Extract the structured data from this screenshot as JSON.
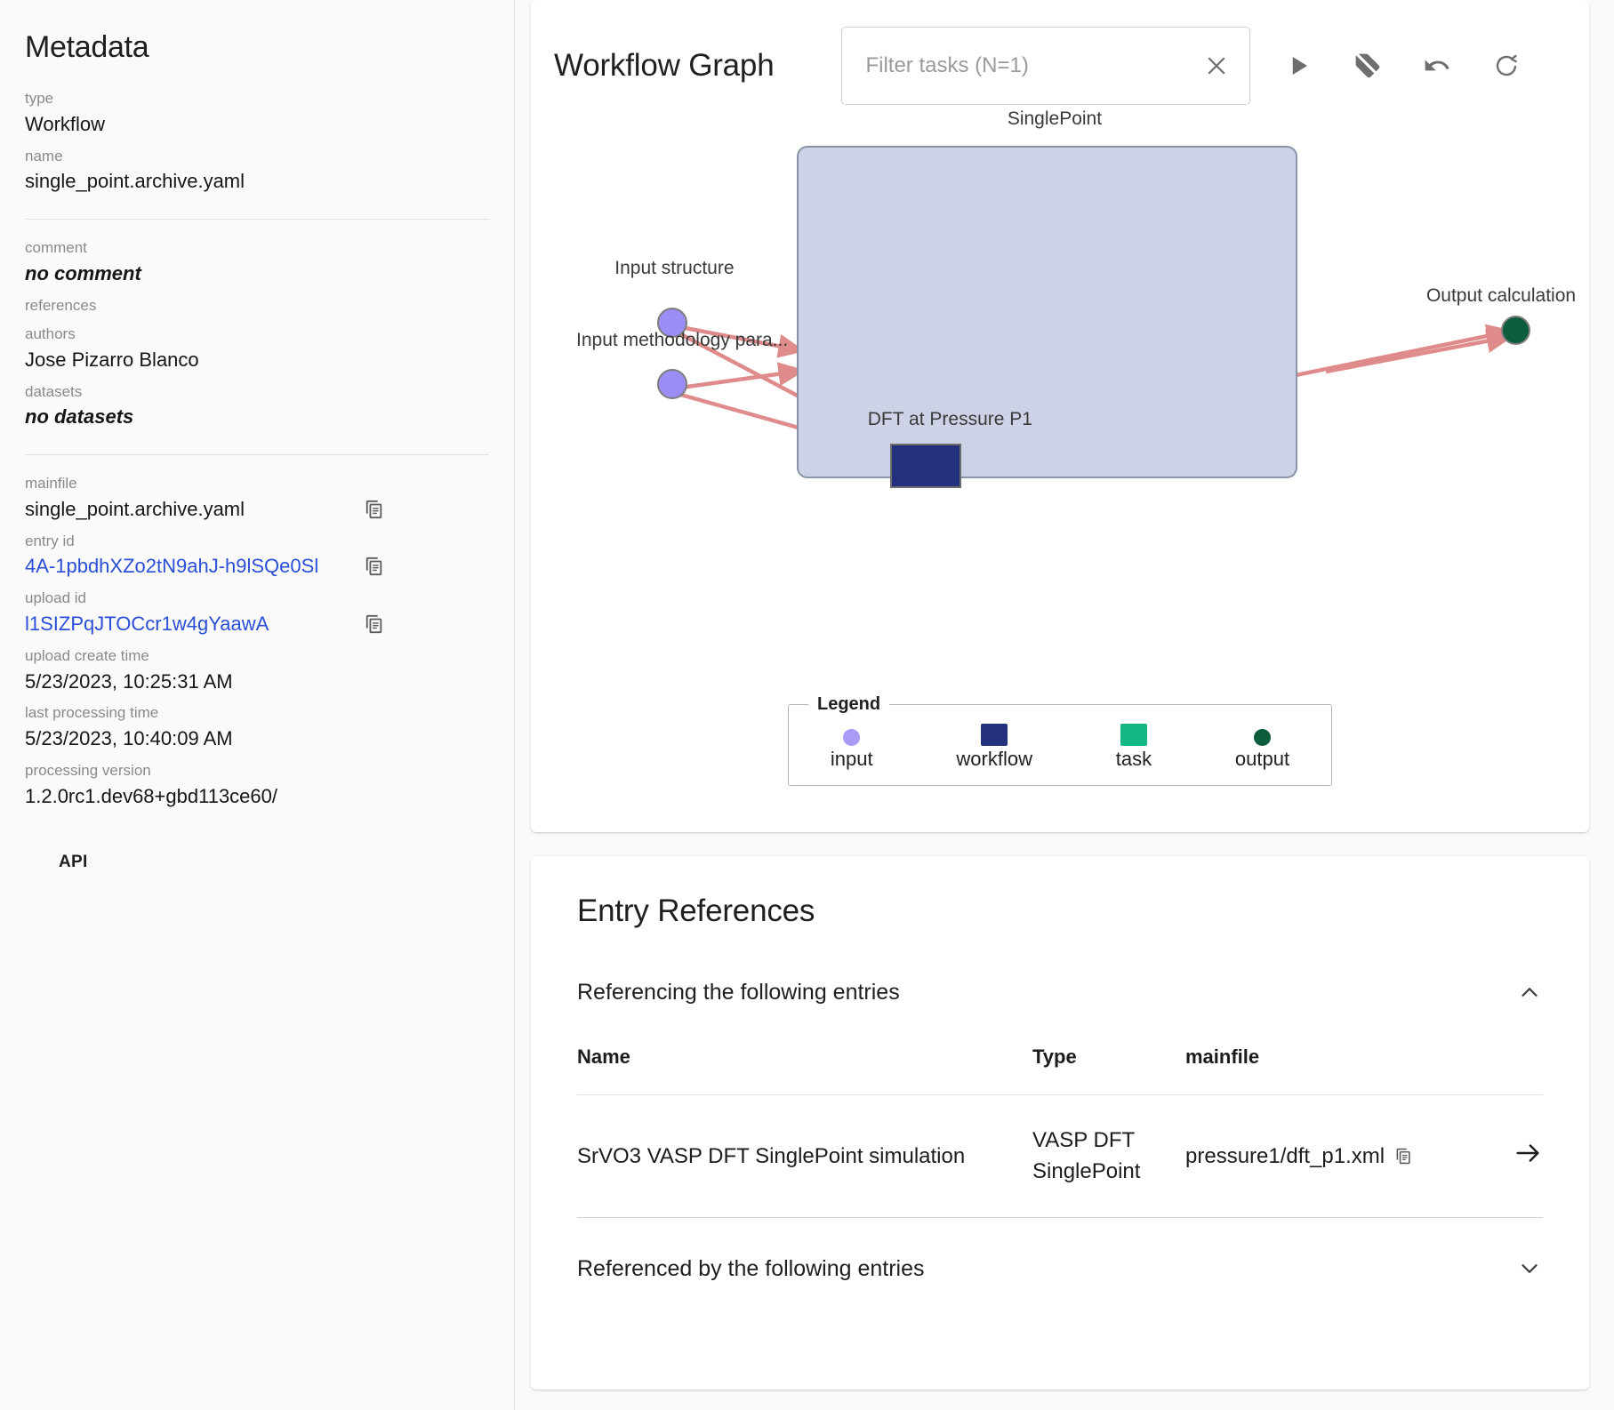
{
  "sidebar": {
    "title": "Metadata",
    "fields": [
      {
        "label": "type",
        "value": "Workflow"
      },
      {
        "label": "name",
        "value": "single_point.archive.yaml"
      },
      {
        "label": "comment",
        "value": "no comment"
      },
      {
        "label": "references",
        "value": ""
      },
      {
        "label": "authors",
        "value": "Jose Pizarro Blanco"
      },
      {
        "label": "datasets",
        "value": "no datasets"
      },
      {
        "label": "mainfile",
        "value": "single_point.archive.yaml"
      },
      {
        "label": "entry id",
        "value": "4A-1pbdhXZo2tN9ahJ-h9lSQe0Sl"
      },
      {
        "label": "upload id",
        "value": "l1SIZPqJTOCcr1w4gYaawA"
      },
      {
        "label": "upload create time",
        "value": "5/23/2023, 10:25:31 AM"
      },
      {
        "label": "last processing time",
        "value": "5/23/2023, 10:40:09 AM"
      },
      {
        "label": "processing version",
        "value": "1.2.0rc1.dev68+gbd113ce60/"
      }
    ],
    "api_button": "API",
    "copy_icon": "clipboard-copy-icon"
  },
  "graph": {
    "title": "Workflow Graph",
    "filter": {
      "value": "",
      "placeholder": "Filter tasks (N=1)"
    },
    "clear_icon": "close-icon",
    "tools": [
      {
        "name": "play-button",
        "icon": "play-icon"
      },
      {
        "name": "hide-labels-button",
        "icon": "label-off-icon"
      },
      {
        "name": "undo-button",
        "icon": "undo-icon"
      },
      {
        "name": "reset-button",
        "icon": "restart-icon"
      }
    ],
    "nodes": {
      "workflow_label": "SinglePoint",
      "input_structure": "Input structure",
      "input_methodology": "Input methodology para...",
      "task": "DFT at Pressure P1",
      "output": "Output calculation"
    },
    "colors": {
      "input": "#9a8ef5",
      "workflow": "#23307e",
      "task": "#14b887",
      "output": "#0b5d3b",
      "workflow_box_fill": "#cdd2e6",
      "workflow_box_stroke": "#8994a6",
      "edge": "#e08b8b"
    },
    "legend": {
      "title": "Legend",
      "items": [
        {
          "label": "input",
          "shape": "circle",
          "color": "#a99cf7"
        },
        {
          "label": "workflow",
          "shape": "rect",
          "color": "#23307e"
        },
        {
          "label": "task",
          "shape": "rect",
          "color": "#14b887"
        },
        {
          "label": "output",
          "shape": "circle",
          "color": "#0b5d3b"
        }
      ]
    }
  },
  "references": {
    "title": "Entry References",
    "referencing": {
      "header": "Referencing the following entries",
      "expanded_icon": "chevron-up-icon",
      "columns": [
        "Name",
        "Type",
        "mainfile"
      ],
      "rows": [
        {
          "name": "SrVO3 VASP DFT SinglePoint simulation",
          "type": "VASP DFT SinglePoint",
          "mainfile": "pressure1/dft_p1.xml",
          "copy_icon": "clipboard-copy-icon",
          "go_icon": "arrow-right-icon"
        }
      ]
    },
    "referenced_by": {
      "header": "Referenced by the following entries",
      "collapsed_icon": "chevron-down-icon"
    }
  }
}
